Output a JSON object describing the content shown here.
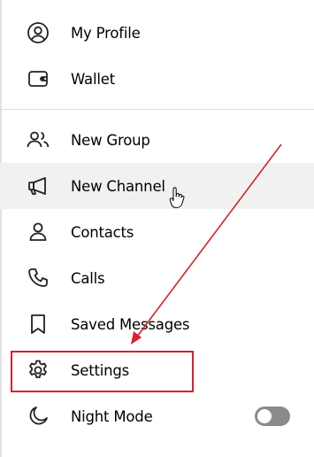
{
  "menu": {
    "items": [
      {
        "label": "My Profile",
        "icon": "user-circle-icon"
      },
      {
        "label": "Wallet",
        "icon": "wallet-icon"
      },
      {
        "label": "New Group",
        "icon": "users-icon"
      },
      {
        "label": "New Channel",
        "icon": "megaphone-icon"
      },
      {
        "label": "Contacts",
        "icon": "user-icon"
      },
      {
        "label": "Calls",
        "icon": "phone-icon"
      },
      {
        "label": "Saved Messages",
        "icon": "bookmark-icon"
      },
      {
        "label": "Settings",
        "icon": "gear-icon"
      },
      {
        "label": "Night Mode",
        "icon": "moon-icon"
      }
    ],
    "night_mode_enabled": false,
    "hovered_item": "New Channel"
  },
  "annotation": {
    "color": "#d9202c",
    "highlighted_item": "Settings"
  },
  "colors": {
    "icon": "#222222",
    "text": "#000000",
    "hover_bg": "#f1f1f1",
    "toggle_off": "#8a8a8a"
  }
}
